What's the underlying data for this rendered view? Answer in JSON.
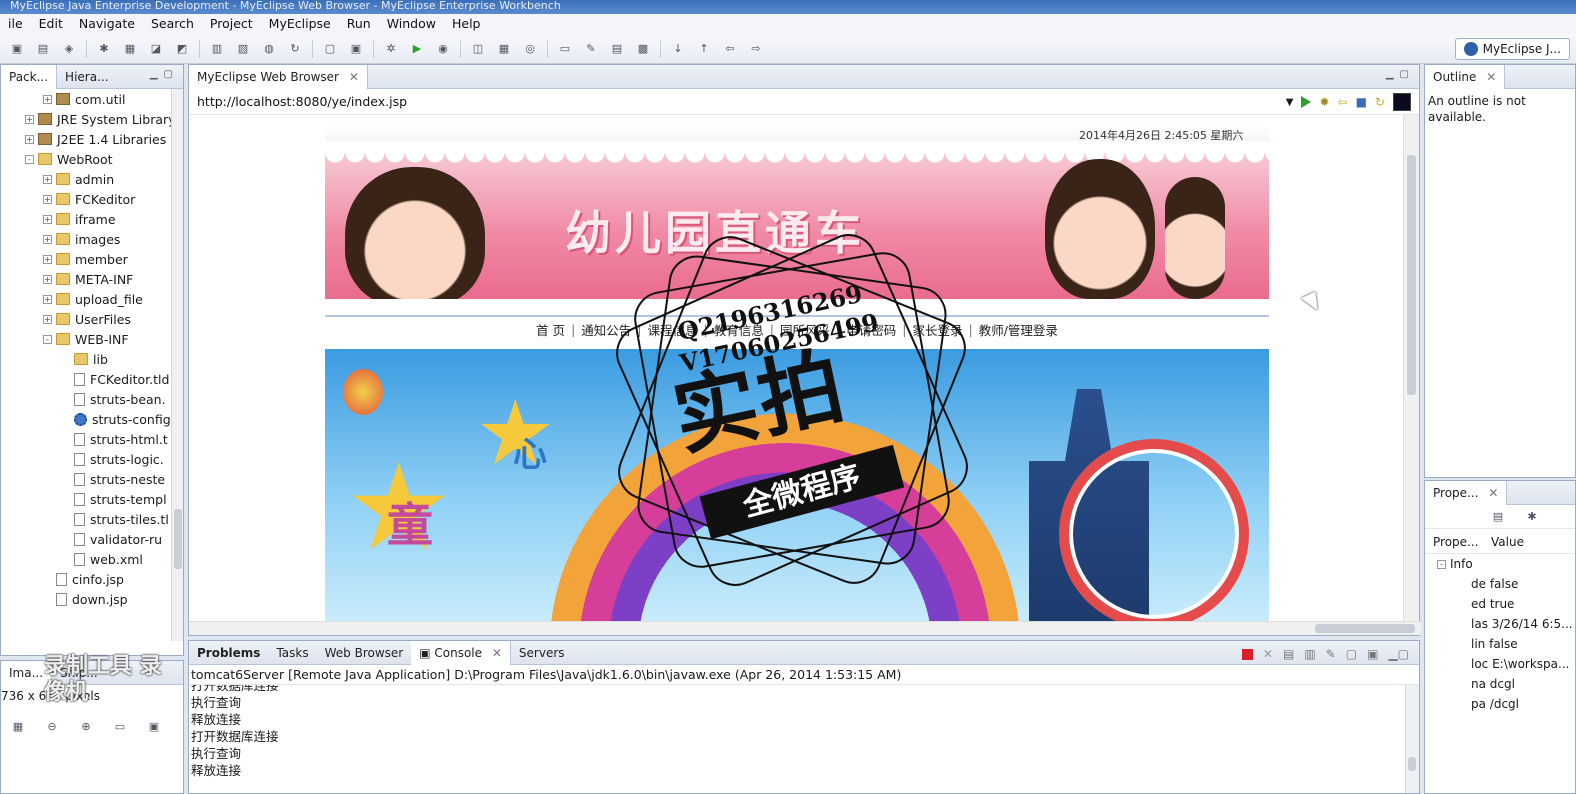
{
  "window": {
    "title": "MyEclipse Java Enterprise Development - MyEclipse Web Browser - MyEclipse Enterprise Workbench"
  },
  "menu": [
    "ile",
    "Edit",
    "Navigate",
    "Search",
    "Project",
    "MyEclipse",
    "Run",
    "Window",
    "Help"
  ],
  "perspective": {
    "label": "MyEclipse J..."
  },
  "explorer": {
    "tabs": [
      "Pack...",
      "Hiera..."
    ],
    "items": [
      {
        "label": "com.util",
        "indent": 2,
        "icon": "jar-icon",
        "exp": "+"
      },
      {
        "label": "JRE System Library",
        "indent": 1,
        "icon": "jar-icon",
        "exp": "+"
      },
      {
        "label": "J2EE 1.4 Libraries",
        "indent": 1,
        "icon": "jar-icon",
        "exp": "+"
      },
      {
        "label": "WebRoot",
        "indent": 1,
        "icon": "folder-icon",
        "exp": "-"
      },
      {
        "label": "admin",
        "indent": 2,
        "icon": "folder-icon",
        "exp": "+"
      },
      {
        "label": "FCKeditor",
        "indent": 2,
        "icon": "folder-icon",
        "exp": "+"
      },
      {
        "label": "iframe",
        "indent": 2,
        "icon": "folder-icon",
        "exp": "+"
      },
      {
        "label": "images",
        "indent": 2,
        "icon": "folder-icon",
        "exp": "+"
      },
      {
        "label": "member",
        "indent": 2,
        "icon": "folder-icon",
        "exp": "+"
      },
      {
        "label": "META-INF",
        "indent": 2,
        "icon": "folder-icon",
        "exp": "+"
      },
      {
        "label": "upload_file",
        "indent": 2,
        "icon": "folder-icon",
        "exp": "+"
      },
      {
        "label": "UserFiles",
        "indent": 2,
        "icon": "folder-icon",
        "exp": "+"
      },
      {
        "label": "WEB-INF",
        "indent": 2,
        "icon": "folder-icon",
        "exp": "-"
      },
      {
        "label": "lib",
        "indent": 3,
        "icon": "folder-icon",
        "exp": ""
      },
      {
        "label": "FCKeditor.tld",
        "indent": 3,
        "icon": "file-icon",
        "exp": ""
      },
      {
        "label": "struts-bean.",
        "indent": 3,
        "icon": "file-icon",
        "exp": ""
      },
      {
        "label": "struts-config",
        "indent": 3,
        "icon": "gear-icon",
        "exp": ""
      },
      {
        "label": "struts-html.t",
        "indent": 3,
        "icon": "file-icon",
        "exp": ""
      },
      {
        "label": "struts-logic.",
        "indent": 3,
        "icon": "file-icon",
        "exp": ""
      },
      {
        "label": "struts-neste",
        "indent": 3,
        "icon": "file-icon",
        "exp": ""
      },
      {
        "label": "struts-templ",
        "indent": 3,
        "icon": "file-icon",
        "exp": ""
      },
      {
        "label": "struts-tiles.tl",
        "indent": 3,
        "icon": "file-icon",
        "exp": ""
      },
      {
        "label": "validator-ru",
        "indent": 3,
        "icon": "file-icon",
        "exp": ""
      },
      {
        "label": "web.xml",
        "indent": 3,
        "icon": "file-icon",
        "exp": ""
      },
      {
        "label": "cinfo.jsp",
        "indent": 2,
        "icon": "file-icon",
        "exp": ""
      },
      {
        "label": "down.jsp",
        "indent": 2,
        "icon": "file-icon",
        "exp": ""
      }
    ]
  },
  "image_panel": {
    "tab": "Ima...",
    "tab2": "Snip...",
    "size": "736 x 631 pixels"
  },
  "browser": {
    "tab": "MyEclipse Web Browser",
    "url": "http://localhost:8080/ye/index.jsp",
    "page": {
      "datetime": "2014年4月26日  2:45:05   星期六",
      "banner_title": "幼儿园直通车",
      "nav": [
        "首 页",
        "通知公告",
        "课程信息",
        "教育信息",
        "园所风采",
        "申请密码",
        "家长登录",
        "教师/管理登录"
      ],
      "hero_text": [
        "童",
        "心"
      ]
    }
  },
  "watermark": {
    "line1": "Q2196316269",
    "line2": "V17060256499",
    "big": "实拍",
    "ribbon": "全微程序"
  },
  "outline": {
    "tab": "Outline",
    "message": "An outline is not available."
  },
  "properties": {
    "tab": "Prope...",
    "col_property": "Prope...",
    "col_value": "Value",
    "group": "Info",
    "rows": [
      "de false",
      "ed true",
      "las 3/26/14 6:5...",
      "lin false",
      "loc E:\\workspa...",
      "na dcgl",
      "pa /dcgl"
    ]
  },
  "console": {
    "tabs": [
      "Problems",
      "Tasks",
      "Web Browser",
      "Console",
      "Servers"
    ],
    "description": "tomcat6Server [Remote Java Application] D:\\Program Files\\Java\\jdk1.6.0\\bin\\javaw.exe (Apr 26, 2014 1:53:15 AM)",
    "lines": [
      "打开数据库连接",
      "执行查询",
      "释放连接",
      "打开数据库连接",
      "执行查询",
      "释放连接"
    ]
  },
  "overlay": {
    "text": "录制工具 录像机"
  }
}
